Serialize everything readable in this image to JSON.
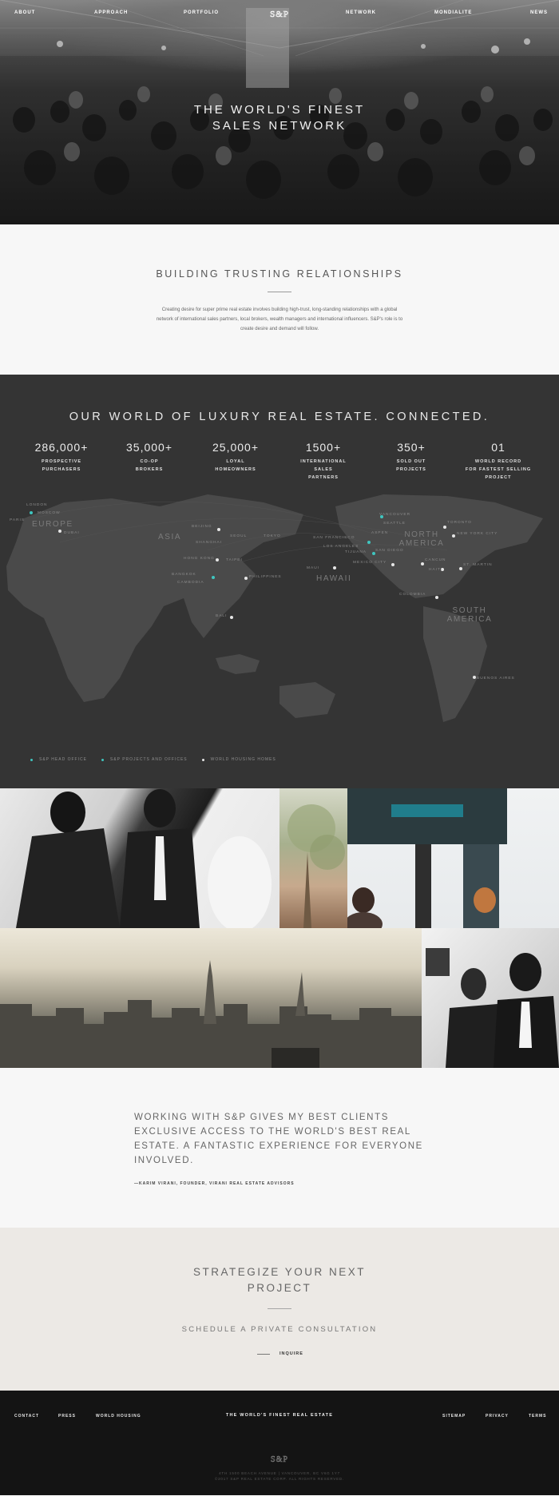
{
  "nav": {
    "left": [
      "ABOUT",
      "APPROACH",
      "PORTFOLIO"
    ],
    "right": [
      "NETWORK",
      "MONDIALITE",
      "NEWS"
    ],
    "logo": "S&P"
  },
  "hero": {
    "title_line1": "THE WORLD'S FINEST",
    "title_line2": "SALES NETWORK"
  },
  "relationships": {
    "heading": "BUILDING TRUSTING RELATIONSHIPS",
    "body": "Creating desire for super prime real estate involves building high-trust, long-standing relationships with a global network of international sales partners, local brokers, wealth managers and international influencers. S&P's role is to create desire and demand will follow."
  },
  "network": {
    "heading": "OUR WORLD OF LUXURY REAL ESTATE. CONNECTED.",
    "stats": [
      {
        "value": "286,000+",
        "label_lines": [
          "PROSPECTIVE",
          "PURCHASERS"
        ]
      },
      {
        "value": "35,000+",
        "label_lines": [
          "CO-OP",
          "BROKERS"
        ]
      },
      {
        "value": "25,000+",
        "label_lines": [
          "LOYAL",
          "HOMEOWNERS"
        ]
      },
      {
        "value": "1500+",
        "label_lines": [
          "INTERNATIONAL",
          "SALES",
          "PARTNERS"
        ]
      },
      {
        "value": "350+",
        "label_lines": [
          "SOLD OUT",
          "PROJECTS"
        ]
      },
      {
        "value": "01",
        "label_lines": [
          "WORLD RECORD",
          "FOR FASTEST SELLING",
          "PROJECT"
        ]
      }
    ],
    "regions": [
      "EUROPE",
      "ASIA",
      "NORTH AMERICA",
      "HAWAII",
      "SOUTH AMERICA"
    ],
    "cities": [
      "LONDON",
      "MOSCOW",
      "PARIS",
      "DUBAI",
      "BEIJING",
      "SHANGHAI",
      "SEOUL",
      "TOKYO",
      "HONG KONG",
      "TAIPEI",
      "BANGKOK",
      "CAMBODIA",
      "PHILIPPINES",
      "BALI",
      "SAN FRANCISCO",
      "LOS ANGELES",
      "TIJUANA",
      "SAN DIEGO",
      "VANCOUVER",
      "SEATTLE",
      "ASPEN",
      "TORONTO",
      "NEW YORK CITY",
      "MAUI",
      "MEXICO CITY",
      "CANCUN",
      "HAITI",
      "ST. MARTIN",
      "COLOMBIA",
      "BUENOS AIRES"
    ],
    "legend": [
      {
        "label": "S&P HEAD OFFICE",
        "color": "#3fc6c0"
      },
      {
        "label": "S&P PROJECTS AND OFFICES",
        "color": "#3fc6c0"
      },
      {
        "label": "WORLD HOUSING HOMES",
        "color": "#e6e6e6"
      }
    ]
  },
  "testimonial": {
    "quote": "WORKING WITH S&P GIVES MY BEST CLIENTS EXCLUSIVE ACCESS TO THE WORLD'S BEST REAL ESTATE. A FANTASTIC EXPERIENCE FOR EVERYONE INVOLVED.",
    "cite": "—KARIM VIRANI, FOUNDER, VIRANI REAL ESTATE ADVISORS"
  },
  "cta": {
    "heading": "STRATEGIZE YOUR NEXT PROJECT",
    "subheading": "SCHEDULE A PRIVATE CONSULTATION",
    "button": "INQUIRE"
  },
  "footer": {
    "left_links": [
      "CONTACT",
      "PRESS",
      "WORLD HOUSING"
    ],
    "tagline": "THE WORLD'S FINEST REAL ESTATE",
    "right_links": [
      "SITEMAP",
      "PRIVACY",
      "TERMS"
    ],
    "logo": "S&P",
    "address": "4TH 1500 BEACH AVENUE | VANCOUVER, BC V6G 1Y7",
    "copyright": "©2017 S&P REAL ESTATE CORP. ALL RIGHTS RESERVED."
  }
}
